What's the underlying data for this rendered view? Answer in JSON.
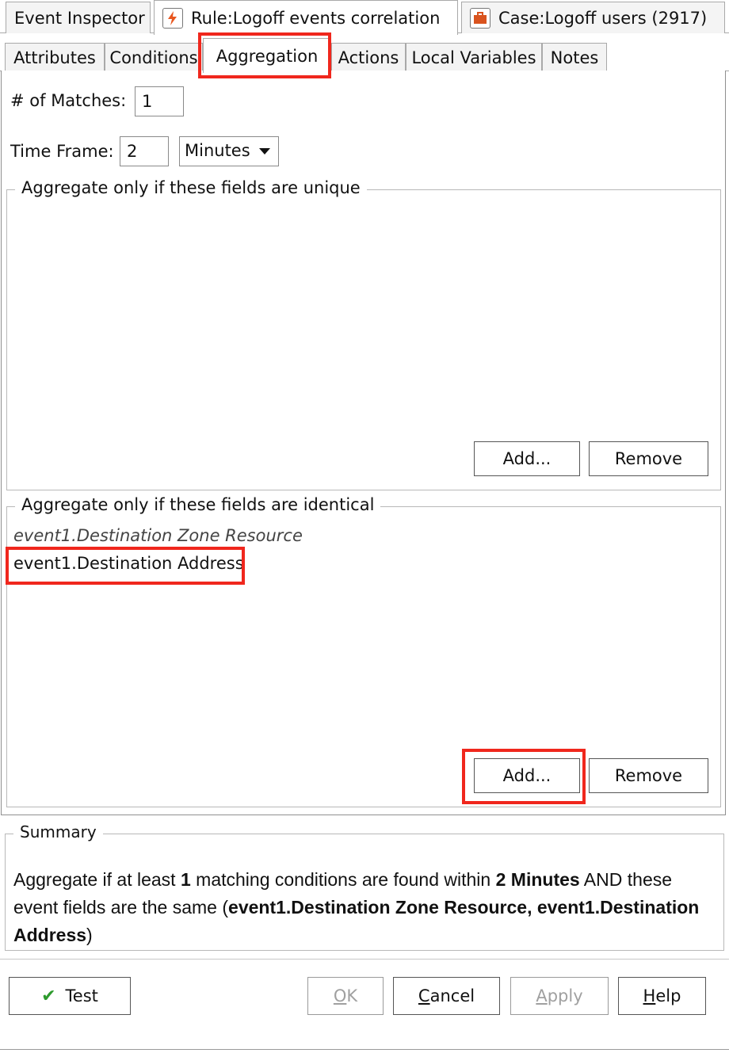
{
  "editor_tabs": [
    {
      "label": "Event Inspector",
      "icon": "none"
    },
    {
      "label": "Rule:Logoff events correlation",
      "icon": "rule-lightning-icon"
    },
    {
      "label": "Case:Logoff users (2917)",
      "icon": "case-briefcase-icon"
    }
  ],
  "sub_tabs": [
    "Attributes",
    "Conditions",
    "Aggregation",
    "Actions",
    "Local Variables",
    "Notes"
  ],
  "active_sub_tab": "Aggregation",
  "matches": {
    "label": "# of Matches:",
    "value": "1"
  },
  "time_frame": {
    "label": "Time Frame:",
    "value": "2",
    "unit": "Minutes"
  },
  "unique_group": {
    "title": "Aggregate only if these fields are unique",
    "items": [],
    "add_label": "Add...",
    "remove_label": "Remove"
  },
  "identical_group": {
    "title": "Aggregate only if these fields are identical",
    "items": [
      "event1.Destination Zone Resource",
      "event1.Destination Address"
    ],
    "add_label": "Add...",
    "remove_label": "Remove"
  },
  "summary": {
    "title": "Summary",
    "p1": "Aggregate if at least ",
    "count": "1",
    "p2": " matching conditions are found within ",
    "window": "2 Minutes",
    "p3": " AND these event fields are the same (",
    "fields": "event1.Destination Zone Resource, event1.Destination Address",
    "p4": ")"
  },
  "buttons": {
    "test": "Test",
    "ok_u": "O",
    "ok_rest": "K",
    "cancel_u": "C",
    "cancel_rest": "ancel",
    "apply_u": "A",
    "apply_rest": "pply",
    "help_u": "H",
    "help_rest": "elp"
  },
  "colors": {
    "highlight": "#f0271d",
    "check": "#2d9a2d",
    "rule_icon": "#e8561e",
    "case_icon": "#d9531e"
  }
}
